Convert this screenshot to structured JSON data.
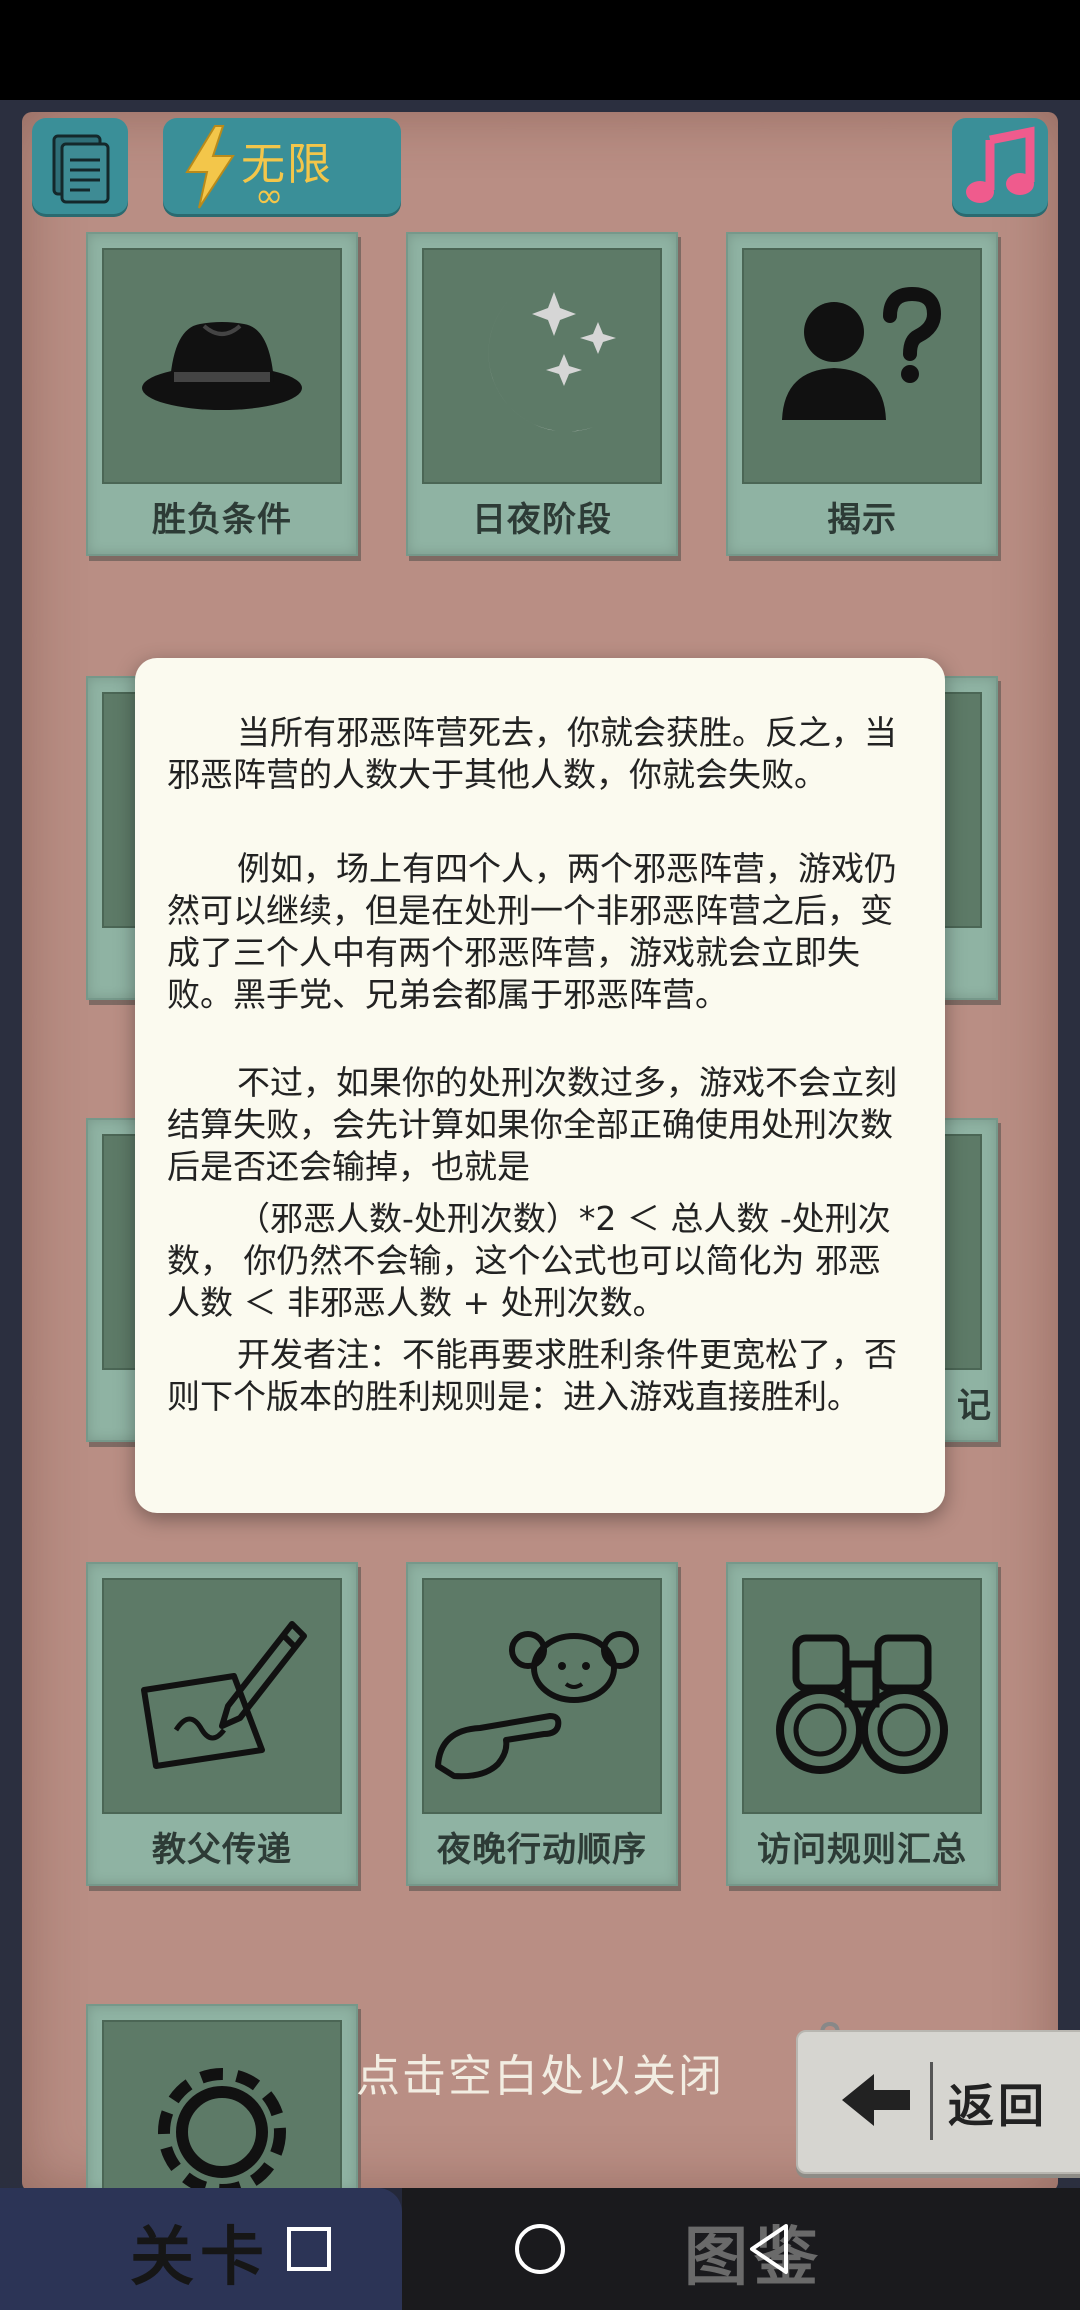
{
  "top_bar": {
    "infinite_label": "无限",
    "infinite_symbol": "∞"
  },
  "cards": [
    {
      "label": "胜负条件",
      "icon": "fedora-hat-icon"
    },
    {
      "label": "日夜阶段",
      "icon": "moon-stars-icon"
    },
    {
      "label": "揭示",
      "icon": "person-question-icon"
    },
    {
      "label": "教父传递",
      "icon": "pen-signature-icon"
    },
    {
      "label": "夜晚行动顺序",
      "icon": "pointing-sheep-icon"
    },
    {
      "label": "访问规则汇总",
      "icon": "binoculars-icon"
    }
  ],
  "hidden_card_fragment": "记",
  "dialog": {
    "paragraphs": [
      "当所有邪恶阵营死去，你就会获胜。反之，当邪恶阵营的人数大于其他人数，你就会失败。",
      "例如，场上有四个人，两个邪恶阵营，游戏仍然可以继续，但是在处刑一个非邪恶阵营之后，变成了三个人中有两个邪恶阵营，游戏就会立即失败。黑手党、兄弟会都属于邪恶阵营。",
      "不过，如果你的处刑次数过多，游戏不会立刻结算失败，会先计算如果你全部正确使用处刑次数后是否还会输掉，也就是",
      "（邪恶人数-处刑次数）*2 ＜ 总人数 -处刑次数，  你仍然不会输，这个公式也可以简化为 邪恶人数 ＜ 非邪恶人数 + 处刑次数。",
      "开发者注：不能再要求胜利条件更宽松了，否则下个版本的胜利规则是：进入游戏直接胜利。"
    ]
  },
  "close_hint": "点击空白处以关闭",
  "back_button": {
    "label": "返回"
  },
  "bottom_tabs": {
    "level": "关卡",
    "guide": "图鉴"
  },
  "colors": {
    "board": "#b98e84",
    "card": "#8fb3a3",
    "card_inner": "#5d7a67",
    "dialog": "#fbfaef",
    "accent_teal": "#3a8f98",
    "accent_gold": "#f3c64a"
  }
}
